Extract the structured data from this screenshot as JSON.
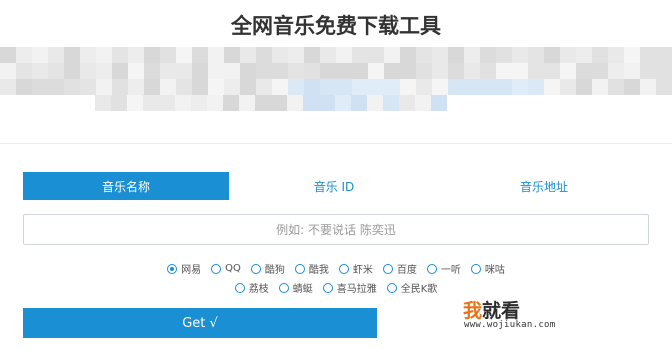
{
  "page": {
    "title": "全网音乐免费下载工具"
  },
  "tabs": [
    {
      "label": "音乐名称",
      "active": true
    },
    {
      "label": "音乐 ID",
      "active": false
    },
    {
      "label": "音乐地址",
      "active": false
    }
  ],
  "search": {
    "placeholder": "例如: 不要说话 陈奕迅",
    "value": ""
  },
  "sources": {
    "row1": [
      {
        "label": "网易",
        "checked": true
      },
      {
        "label": "QQ",
        "checked": false
      },
      {
        "label": "酷狗",
        "checked": false
      },
      {
        "label": "酷我",
        "checked": false
      },
      {
        "label": "虾米",
        "checked": false
      },
      {
        "label": "百度",
        "checked": false
      },
      {
        "label": "一听",
        "checked": false
      },
      {
        "label": "咪咕",
        "checked": false
      }
    ],
    "row2": [
      {
        "label": "荔枝",
        "checked": false
      },
      {
        "label": "蜻蜓",
        "checked": false
      },
      {
        "label": "喜马拉雅",
        "checked": false
      },
      {
        "label": "全民K歌",
        "checked": false
      }
    ]
  },
  "submit": {
    "label": "Get √"
  },
  "watermark": {
    "main_1": "我",
    "main_2": "就看",
    "sub": "www.wojiukan.com"
  },
  "colors": {
    "accent": "#1a8fd4",
    "watermark_orange": "#e8731a"
  }
}
